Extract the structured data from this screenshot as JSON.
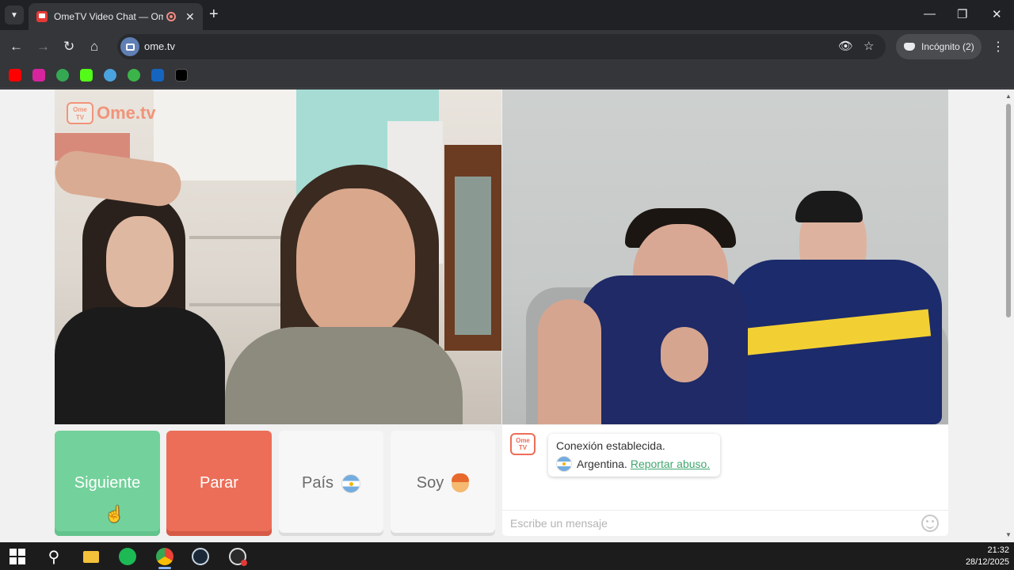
{
  "browser": {
    "tab_title": "OmeTV Video Chat — Ome",
    "new_tab": "+",
    "close_tab": "✕",
    "url": "ome.tv",
    "incognito_label": "Incógnito (2)",
    "window_controls": {
      "minimize": "—",
      "restore": "❐",
      "close": "✕"
    },
    "nav": {
      "back": "←",
      "forward": "→",
      "reload": "↻",
      "home": "⌂"
    },
    "bookmarks": [
      {
        "icon": "youtube-icon",
        "color": "#ff0000"
      },
      {
        "icon": "instagram-icon",
        "color": "#d6249f"
      },
      {
        "icon": "xbox-icon",
        "color": "#34a853"
      },
      {
        "icon": "kick-icon",
        "color": "#53fc18"
      },
      {
        "icon": "fish-icon",
        "color": "#4aa3df"
      },
      {
        "icon": "seventeen-icon",
        "color": "#3bb54a"
      },
      {
        "icon": "paypal-icon",
        "color": "#1565c0"
      },
      {
        "icon": "tiktok-icon",
        "color": "#000000"
      }
    ]
  },
  "watermark": {
    "tv_label": "Ome TV",
    "text": "Ome.tv"
  },
  "controls": {
    "next_label": "Siguiente",
    "stop_label": "Parar",
    "country_label": "País",
    "gender_label": "Soy"
  },
  "chat": {
    "logo_label": "Ome TV",
    "status": "Conexión establecida.",
    "country": "Argentina.",
    "report_link": "Reportar abuso.",
    "input_placeholder": "Escribe un mensaje"
  },
  "taskbar": {
    "time": "21:32",
    "date": "28/12/2025",
    "apps": [
      "start-icon",
      "search-icon",
      "file-explorer-icon",
      "spotify-icon",
      "chrome-icon",
      "steam-icon",
      "obs-icon"
    ]
  },
  "colors": {
    "next": "#73d19b",
    "stop": "#ec6e58",
    "link": "#3fa76e"
  }
}
